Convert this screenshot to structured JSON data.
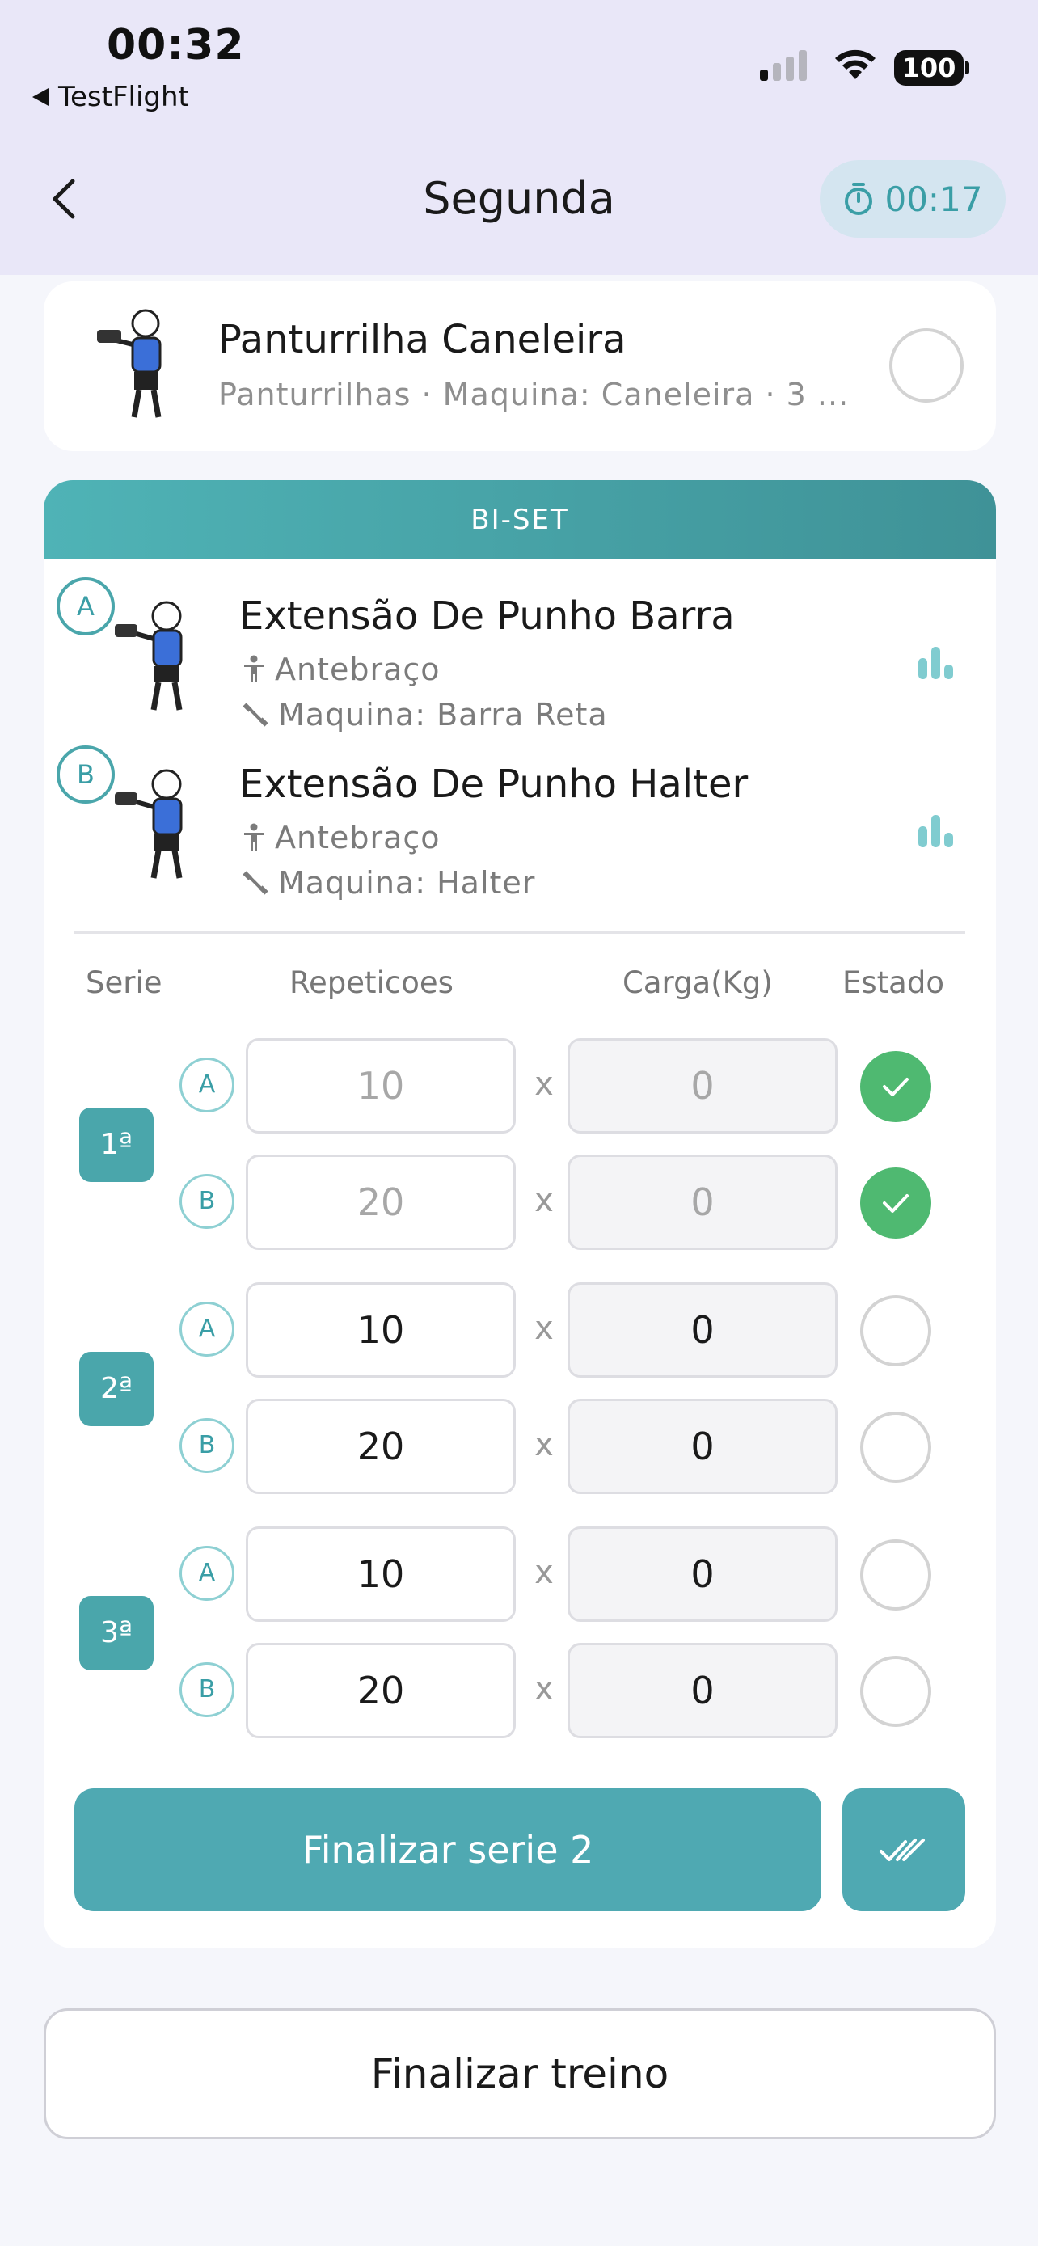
{
  "status_bar": {
    "time": "00:32",
    "back_app": "TestFlight",
    "battery": "100"
  },
  "header": {
    "title": "Segunda",
    "timer": "00:17"
  },
  "exercise_single": {
    "name": "Panturrilha Caneleira",
    "details": "Panturrilhas · Maquina: Caneleira · 3 ..."
  },
  "biset": {
    "label": "BI-SET",
    "exercises": [
      {
        "letter": "A",
        "name": "Extensão De Punho Barra",
        "muscle": "Antebraço",
        "equipment": "Maquina: Barra Reta"
      },
      {
        "letter": "B",
        "name": "Extensão De Punho Halter",
        "muscle": "Antebraço",
        "equipment": "Maquina: Halter"
      }
    ],
    "columns": {
      "serie": "Serie",
      "reps": "Repeticoes",
      "load": "Carga(Kg)",
      "state": "Estado"
    },
    "sets": [
      {
        "label": "1ª",
        "rows": [
          {
            "letter": "A",
            "reps": "10",
            "load": "0",
            "done": true
          },
          {
            "letter": "B",
            "reps": "20",
            "load": "0",
            "done": true
          }
        ]
      },
      {
        "label": "2ª",
        "rows": [
          {
            "letter": "A",
            "reps": "10",
            "load": "0",
            "done": false
          },
          {
            "letter": "B",
            "reps": "20",
            "load": "0",
            "done": false
          }
        ]
      },
      {
        "label": "3ª",
        "rows": [
          {
            "letter": "A",
            "reps": "10",
            "load": "0",
            "done": false
          },
          {
            "letter": "B",
            "reps": "20",
            "load": "0",
            "done": false
          }
        ]
      }
    ],
    "times_symbol": "x",
    "finish_set_button": "Finalizar serie 2"
  },
  "finish_workout_button": "Finalizar treino",
  "colors": {
    "accent": "#4fa9b2",
    "success": "#4fb971",
    "header_bg": "#e9e7f8"
  },
  "icons": {
    "back": "chevron-left-icon",
    "timer": "stopwatch-icon",
    "muscle": "person-icon",
    "equipment": "dumbbell-icon",
    "stats": "bar-chart-icon",
    "finish_all": "double-check-icon"
  }
}
